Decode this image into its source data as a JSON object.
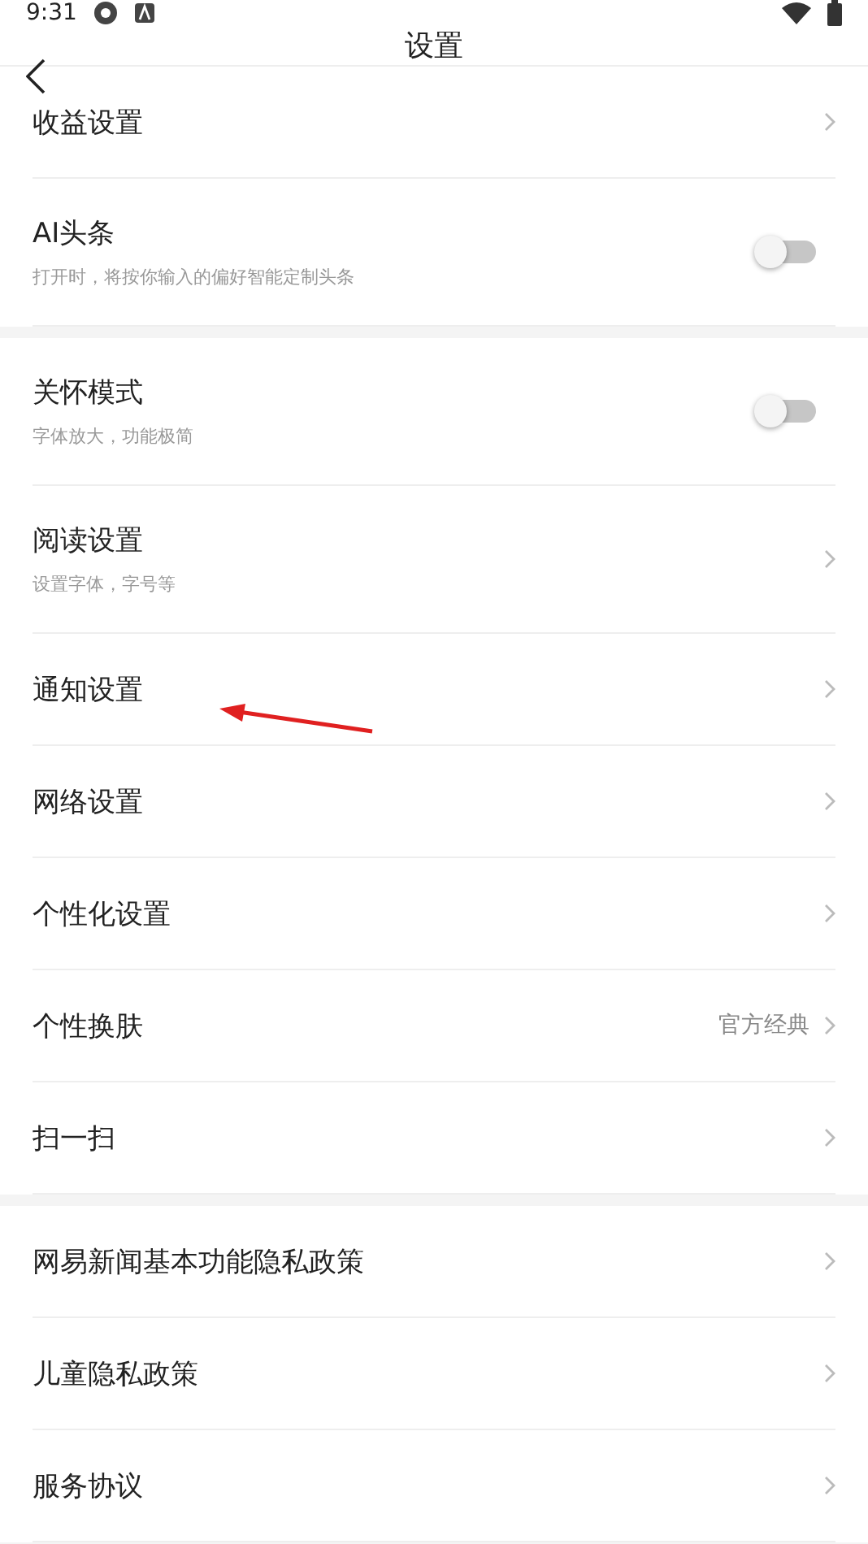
{
  "status_bar": {
    "time": "9:31"
  },
  "header": {
    "title": "设置"
  },
  "sections": [
    {
      "items": [
        {
          "kind": "link",
          "label": "收益设置"
        },
        {
          "kind": "toggle",
          "label": "AI头条",
          "subtitle": "打开时，将按你输入的偏好智能定制头条",
          "on": false
        }
      ]
    },
    {
      "items": [
        {
          "kind": "toggle",
          "label": "关怀模式",
          "subtitle": "字体放大，功能极简",
          "on": false
        },
        {
          "kind": "link",
          "label": "阅读设置",
          "subtitle": "设置字体，字号等"
        },
        {
          "kind": "link",
          "label": "通知设置",
          "annotated": true
        },
        {
          "kind": "link",
          "label": "网络设置"
        },
        {
          "kind": "link",
          "label": "个性化设置"
        },
        {
          "kind": "link",
          "label": "个性换肤",
          "value": "官方经典"
        },
        {
          "kind": "link",
          "label": "扫一扫"
        }
      ]
    },
    {
      "items": [
        {
          "kind": "link",
          "label": "网易新闻基本功能隐私政策"
        },
        {
          "kind": "link",
          "label": "儿童隐私政策"
        },
        {
          "kind": "link",
          "label": "服务协议"
        }
      ]
    }
  ]
}
